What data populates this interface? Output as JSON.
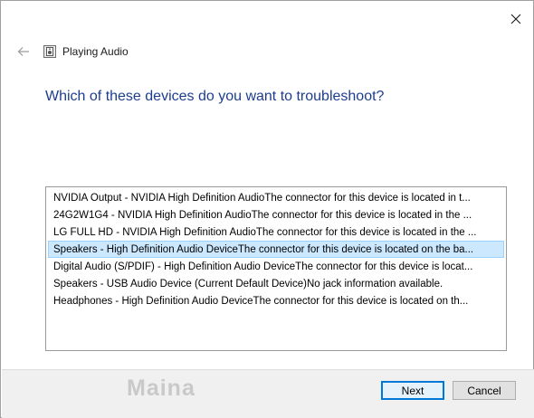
{
  "window": {
    "title": "Playing Audio",
    "close_icon": "close-icon",
    "back_icon": "back-arrow-icon"
  },
  "question": "Which of these devices do you want to troubleshoot?",
  "devices": [
    "NVIDIA Output - NVIDIA High Definition AudioThe connector for this device is located in t...",
    "24G2W1G4 - NVIDIA High Definition AudioThe connector for this device is located in the ...",
    "LG FULL HD - NVIDIA High Definition AudioThe connector for this device is located in the ...",
    "Speakers - High Definition Audio DeviceThe connector for this device is located on the ba...",
    "Digital Audio (S/PDIF) - High Definition Audio DeviceThe connector for this device is locat...",
    "Speakers - USB Audio Device (Current Default Device)No jack information available.",
    "Headphones - High Definition Audio DeviceThe connector for this device is located on th..."
  ],
  "selected_index": 3,
  "footer": {
    "watermark": "Maina",
    "next_label": "Next",
    "cancel_label": "Cancel"
  },
  "colors": {
    "question_text": "#1e3d8f",
    "selection_bg": "#cce8ff",
    "selection_border": "#99d1ff",
    "primary_border": "#0078d7"
  }
}
